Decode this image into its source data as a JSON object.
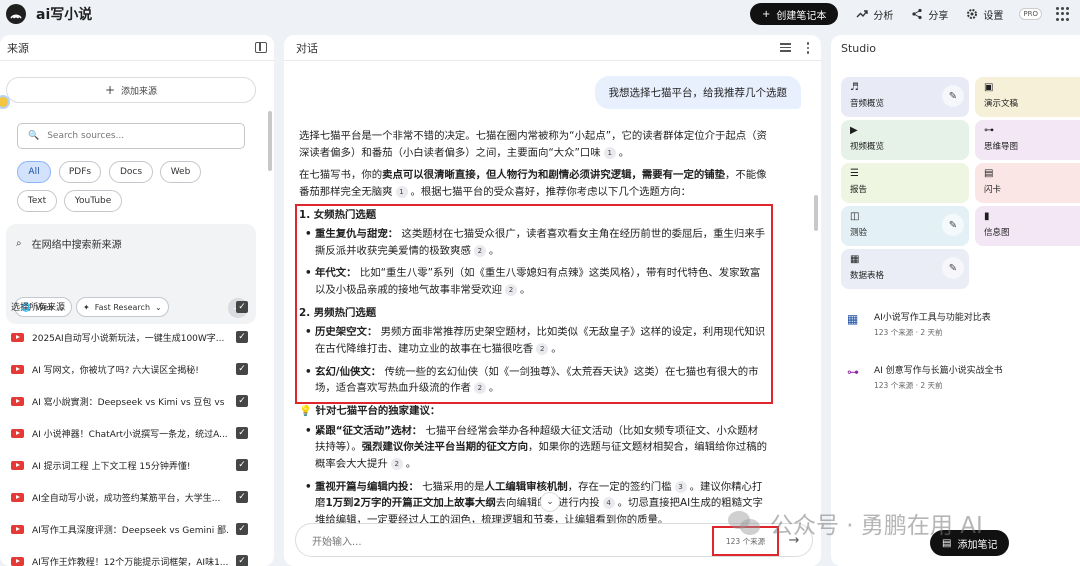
{
  "app": {
    "title": "ai写小说"
  },
  "topbar": {
    "create_label": "创建笔记本",
    "analysis_label": "分析",
    "share_label": "分享",
    "settings_label": "设置",
    "pro_label": "PRO"
  },
  "left": {
    "title": "来源",
    "add_source_label": "添加来源",
    "search_placeholder": "Search sources...",
    "filters": [
      "All",
      "PDFs",
      "Docs",
      "Web",
      "Text",
      "YouTube"
    ],
    "active_filter": "All",
    "web_search": {
      "prompt": "在网络中搜索新来源",
      "mode_label": "Web",
      "research_label": "Fast Research"
    },
    "select_all_label": "选择所有来源",
    "sources": [
      "2025AI自动写小说新玩法，一键生成100W字...",
      "AI 写网文，你被坑了吗? 六大误区全揭秘!",
      "AI 寫小說實測：Deepseek vs Kimi vs 豆包 vs ...",
      "AI 小说神器！ChatArt小说撰写一条龙，统过A...",
      "AI 提示词工程 上下文工程 15分钟弄懂!",
      "AI全自动写小说，成功签约某筋平台，大学生...",
      "AI写作工具深度评测：Deepseek vs Gemini 鄙...",
      "AI写作王炸教程！12个万能提示词框架，AI味1..."
    ]
  },
  "center": {
    "title": "对话",
    "user_message": "我想选择七猫平台，给我推荐几个选题",
    "answer": {
      "p1": "选择七猫平台是一个非常不错的决定。七猫在圈内常被称为“小起点”，它的读者群体定位介于起点（资深读者偏多）和番茄（小白读者偏多）之间，主要面向“大众”口味",
      "p2_pre": "在七猫写书，你的",
      "p2_bold": "卖点可以很清晰直接，但人物行为和剧情必须讲究逻辑，需要有一定的铺垫",
      "p2_post": "，不能像番茄那样完全无脑爽",
      "p2_tail": "。根据七猫平台的受众喜好，推荐你考虑以下几个选题方向：",
      "s1_title": "1. 女频热门选题",
      "s1_i1_label": "重生复仇与甜宠：",
      "s1_i1_text": "这类题材在七猫受众很广，读者喜欢看女主角在经历前世的委屈后，重生归来手撕反派并收获完美爱情的极致爽感",
      "s1_i2_label": "年代文：",
      "s1_i2_text": "比如“重生八零”系列（如《重生八零媳妇有点辣》这类风格），带有时代特色、发家致富以及小极品亲戚的接地气故事非常受欢迎",
      "s2_title": "2. 男频热门选题",
      "s2_i1_label": "历史架空文：",
      "s2_i1_text": "男频方面非常推荐历史架空题材，比如类似《无敌皇子》这样的设定，利用现代知识在古代降维打击、建功立业的故事在七猫很吃香",
      "s2_i2_label": "玄幻/仙侠文：",
      "s2_i2_text": "传统一些的玄幻仙侠（如《一剑独尊》、《太荒吞天诀》这类）在七猫也有很大的市场，适合喜欢写热血升级流的作者",
      "s3_title": "💡 针对七猫平台的独家建议：",
      "s3_i1_label": "紧跟“征文活动”选材：",
      "s3_i1_text": "七猫平台经常会举办各种超级大征文活动（比如女频专项征文、小众题材扶持等）。",
      "s3_i1_bold": "强烈建议你关注平台当期的征文方向",
      "s3_i1_tail": "，如果你的选题与征文题材相契合，编辑给你过稿的概率会大大提升",
      "s3_i2_label": "重视开篇与编辑内投：",
      "s3_i2_text": "七猫采用的是",
      "s3_i2_bold": "人工编辑审核机制",
      "s3_i2_text2": "，存在一定的签约门槛",
      "s3_i2_text3": "。建议你精心打磨",
      "s3_i2_bold2": "1万到2万字的开篇正文加上故事大纲",
      "s3_i2_text4": "去向编辑邮箱进行内投",
      "s3_i2_text5": "。切忌直接把AI生成的粗糙文字堆给编辑，一定要经过人工的润色，梳理逻辑和节奏，让编辑看到你的质量。",
      "citations": {
        "c1": "1",
        "c2": "1",
        "c3": "2",
        "c4": "2",
        "c5": "2",
        "c6": "2",
        "c7": "2",
        "c8": "3",
        "c9": "4"
      }
    },
    "input_placeholder": "开始输入...",
    "source_count": "123 个来源"
  },
  "right": {
    "title": "Studio",
    "tiles": [
      {
        "label": "音频概览",
        "icon": "♬",
        "bg": "#e8eaf6",
        "edit": true
      },
      {
        "label": "演示文稿",
        "icon": "▣",
        "bg": "#f6f0d8",
        "edit": false
      },
      {
        "label": "视频概览",
        "icon": "▶",
        "bg": "#e6f2e8",
        "edit": false
      },
      {
        "label": "思维导图",
        "icon": "⊶",
        "bg": "#f3e6f5",
        "edit": false
      },
      {
        "label": "报告",
        "icon": "☰",
        "bg": "#eef5e0",
        "edit": false
      },
      {
        "label": "闪卡",
        "icon": "▤",
        "bg": "#fbe6e6",
        "edit": false
      },
      {
        "label": "测验",
        "icon": "◫",
        "bg": "#e3f1f6",
        "edit": true
      },
      {
        "label": "信息图",
        "icon": "▮",
        "bg": "#f3e6f5",
        "edit": false
      },
      {
        "label": "数据表格",
        "icon": "▦",
        "bg": "#eaecf6",
        "edit": true
      }
    ],
    "notes": [
      {
        "title": "AI小说写作工具与功能对比表",
        "meta": "123 个来源 · 2 天前",
        "icon": "▦"
      },
      {
        "title": "AI 创意写作与长篇小说实战全书",
        "meta": "123 个来源 · 2 天前",
        "icon": "⊶"
      }
    ],
    "add_note_label": "添加笔记"
  },
  "watermark": {
    "text": "公众号 · 勇鹏在用 AI"
  }
}
